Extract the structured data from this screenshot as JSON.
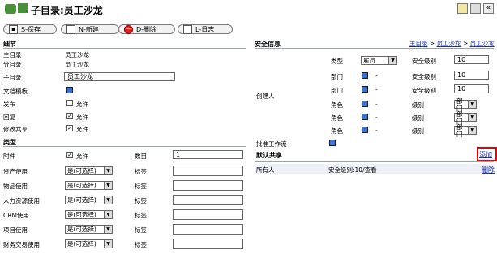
{
  "title": "子目录:员工沙龙",
  "toolbar": {
    "save": "S-保存",
    "new": "N-新建",
    "delete": "D-删除",
    "log": "L-日志"
  },
  "left": {
    "section_detail": "细节",
    "rows": [
      {
        "label": "主目录",
        "value": "员工沙龙"
      },
      {
        "label": "分目录",
        "value": "员工沙龙"
      },
      {
        "label": "子目录",
        "value": "员工沙龙"
      }
    ],
    "doc_template": "文档模板",
    "publish": "发布",
    "publish_opt": "允许",
    "reply": "回复",
    "reply_opt": "允许",
    "modify_share": "修改共享",
    "modify_share_opt": "允许",
    "section_type": "类型",
    "attach": "附件",
    "attach_opt": "允许",
    "count_label": "数目",
    "count_value": "1",
    "uses": [
      {
        "label": "资产使用",
        "value": "是(可选择)"
      },
      {
        "label": "物品使用",
        "value": "是(可选择)"
      },
      {
        "label": "人力资源使用",
        "value": "是(可选择)"
      },
      {
        "label": "CRM使用",
        "value": "是(可选择)"
      },
      {
        "label": "项目使用",
        "value": "是(可选择)"
      },
      {
        "label": "财务交易使用",
        "value": "是(可选择)"
      }
    ],
    "tag_label": "标签"
  },
  "right": {
    "section_security": "安全信息",
    "breadcrumb": [
      "主目录",
      "员工沙龙",
      "员工沙龙"
    ],
    "creator": "创建人",
    "type_label": "类型",
    "type_value": "雇员",
    "sec_level": "安全级别",
    "sec_value": "10",
    "dept": "部门",
    "role": "角色",
    "level": "级别",
    "level_value": "部门",
    "dash": "-",
    "approve_flow": "批准工作流",
    "default_share": "默认共享",
    "add": "添加",
    "everyone": "所有人",
    "share_detail": "安全级别:10/查看",
    "remove": "删除"
  }
}
